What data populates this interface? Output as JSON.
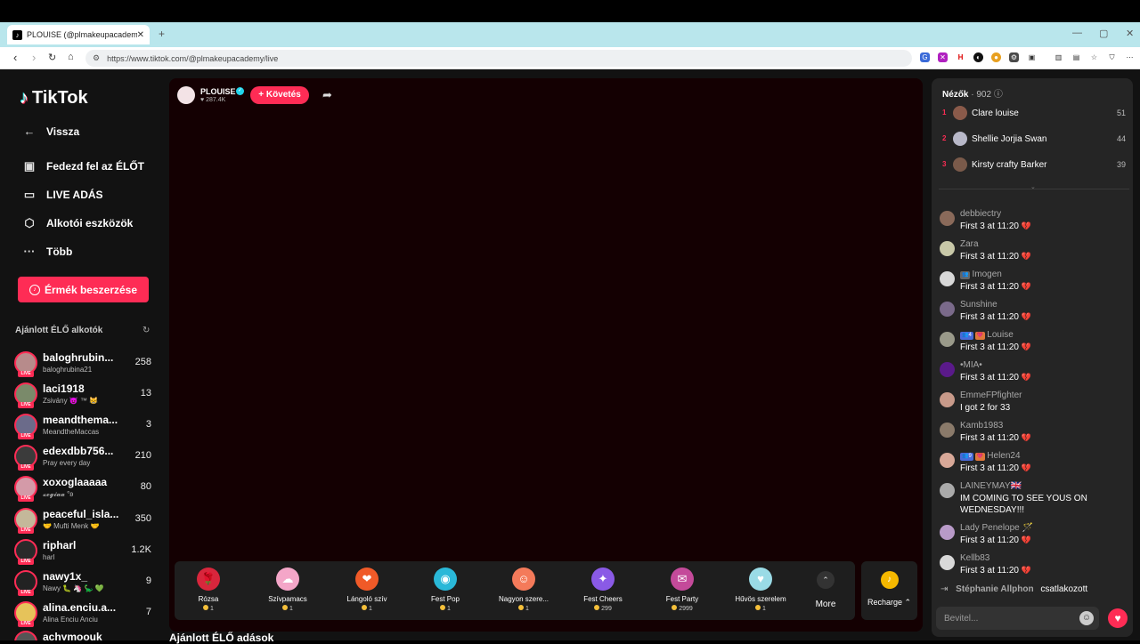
{
  "browser": {
    "tab_title": "PLOUISE (@plmakeupacademy)",
    "url": "https://www.tiktok.com/@plmakeupacademy/live",
    "tab_close": "✕",
    "new_tab": "+",
    "window_min": "—",
    "window_max": "▢",
    "window_close": "✕"
  },
  "sidebar": {
    "logo": "TikTok",
    "nav": [
      {
        "label": "Vissza",
        "icon": "←"
      },
      {
        "label": "Fedezd fel az ÉLŐT",
        "icon": "▣"
      },
      {
        "label": "LIVE ADÁS",
        "icon": "▭"
      },
      {
        "label": "Alkotói eszközök",
        "icon": "⬡"
      },
      {
        "label": "Több",
        "icon": "···"
      }
    ],
    "coins_button": "Érmék beszerzése",
    "recommended_title": "Ajánlott ÉLŐ alkotók",
    "live_badge": "LIVE",
    "creators": [
      {
        "name": "baloghrubin...",
        "sub": "baloghrubina21",
        "count": "258",
        "color": "#b78b8b"
      },
      {
        "name": "laci1918",
        "sub": "Zsivány 😈 ™ 😸",
        "count": "13",
        "color": "#7a8a6a"
      },
      {
        "name": "meandthema...",
        "sub": "MeandtheMaccas",
        "count": "3",
        "color": "#6b6b8a"
      },
      {
        "name": "edexdbb756...",
        "sub": "Pray every day",
        "count": "210",
        "color": "#3b3b3b"
      },
      {
        "name": "xoxoglaaaaa",
        "sub": "𝔁𝓸𝓰𝓲𝓪𝓪 °ʚ",
        "count": "80",
        "color": "#d49aa8"
      },
      {
        "name": "peaceful_isla...",
        "sub": "🤝 Mufti Menk 🤝",
        "count": "350",
        "color": "#c4b89a"
      },
      {
        "name": "ripharl",
        "sub": "harl",
        "count": "1.2K",
        "color": "#2a2a2a"
      },
      {
        "name": "nawy1x_",
        "sub": "Nawy 🐛 🦄 🦕 💚",
        "count": "9",
        "color": "#222"
      },
      {
        "name": "alina.enciu.a...",
        "sub": "Alina Enciu Anciu",
        "count": "7",
        "color": "#e6c35a"
      },
      {
        "name": "achymoouk",
        "sub": "",
        "count": "",
        "color": "#555"
      }
    ],
    "bottom_heading": "Ajánlott ÉLŐ adások"
  },
  "host": {
    "name": "PLOUISE",
    "likes": "♥ 287.4K",
    "follow_label": "+ Követés",
    "share_icon": "➦"
  },
  "gifts": [
    {
      "name": "Rózsa",
      "price": "1",
      "color": "#d8263c",
      "glyph": "🌹"
    },
    {
      "name": "Szívpamacs",
      "price": "1",
      "color": "#f4a6c8",
      "glyph": "☁"
    },
    {
      "name": "Lángoló szív",
      "price": "1",
      "color": "#f05a28",
      "glyph": "❤"
    },
    {
      "name": "Fest Pop",
      "price": "1",
      "color": "#2ab8d8",
      "glyph": "◉"
    },
    {
      "name": "Nagyon szere...",
      "price": "1",
      "color": "#f47a5a",
      "glyph": "☺"
    },
    {
      "name": "Fest Cheers",
      "price": "299",
      "color": "#8a5ae6",
      "glyph": "✦"
    },
    {
      "name": "Fest Party",
      "price": "2999",
      "color": "#c44a9a",
      "glyph": "✉"
    },
    {
      "name": "Hűvös szerelem",
      "price": "1",
      "color": "#9adbe6",
      "glyph": "♥"
    }
  ],
  "gift_more": "More",
  "gift_more_icon": "⌃",
  "recharge": "Recharge ⌃",
  "recharge_icon": "♪",
  "viewers": {
    "title": "Nézők",
    "count": "· 902",
    "help_icon": "ⓘ",
    "top": [
      {
        "rank": "1",
        "name": "Clare louise",
        "score": "51",
        "color": "#8a5a4a"
      },
      {
        "rank": "2",
        "name": "Shellie Jorjia Swan",
        "score": "44",
        "color": "#b8b8c8"
      },
      {
        "rank": "3",
        "name": "Kirsty crafty Barker",
        "score": "39",
        "color": "#7a5a4a"
      }
    ],
    "collapse_icon": "⌄"
  },
  "chat": {
    "messages": [
      {
        "user": "debbiectry",
        "text": "First 3 at 11:20",
        "heart": true,
        "color": "#8a6a5a",
        "badges": []
      },
      {
        "user": "Zara",
        "text": "First 3 at 11:20",
        "heart": true,
        "color": "#c8c8a8",
        "badges": []
      },
      {
        "user": "Imogen",
        "text": "First 3 at 11:20",
        "heart": true,
        "color": "#d8d8d8",
        "badges": [
          {
            "t": "👥",
            "c": "#666"
          }
        ]
      },
      {
        "user": "Sunshine",
        "text": "First 3 at 11:20",
        "heart": true,
        "color": "#7a6a8a",
        "badges": []
      },
      {
        "user": "Louise",
        "text": "First 3 at 11:20",
        "heart": true,
        "color": "#9a9a8a",
        "badges": [
          {
            "t": "👥4",
            "c": "#4a6ad8"
          },
          {
            "t": "💗",
            "c": "#e0783a"
          }
        ]
      },
      {
        "user": "•MIA•",
        "text": "First 3 at 11:20",
        "heart": true,
        "color": "#5a1a8a",
        "badges": []
      },
      {
        "user": "EmmeFPfighter",
        "text": "I got 2 for 33",
        "heart": false,
        "color": "#c89a8a",
        "badges": []
      },
      {
        "user": "Kamb1983",
        "text": "First 3 at 11:20",
        "heart": true,
        "color": "#8a7a6a",
        "badges": []
      },
      {
        "user": "Helen24",
        "text": "First 3 at 11:20",
        "heart": true,
        "color": "#d8a898",
        "badges": [
          {
            "t": "👥9",
            "c": "#4a6ad8"
          },
          {
            "t": "💗",
            "c": "#e0783a"
          }
        ]
      },
      {
        "user": "LAINEYMAY🇬🇧",
        "text": "IM COMING TO SEE YOUS ON WEDNESDAY!!!",
        "heart": false,
        "color": "#aaaaaa",
        "badges": []
      },
      {
        "user": "Lady Penelope 🪄",
        "text": "First 3 at 11:20",
        "heart": true,
        "color": "#b89ac8",
        "badges": []
      },
      {
        "user": "Kellb83",
        "text": "First 3 at 11:20",
        "heart": true,
        "color": "#d8d8d8",
        "badges": []
      }
    ],
    "heart_glyph": "💔",
    "joined_user": "Stéphanie Allphon",
    "joined_text": "csatlakozott",
    "joined_icon": "⇥",
    "input_placeholder": "Bevitel...",
    "emoji_icon": "☺",
    "like_icon": "♥"
  },
  "colors": {
    "accent": "#fe2c55",
    "panel": "#252525",
    "video_bg": "#140002"
  }
}
